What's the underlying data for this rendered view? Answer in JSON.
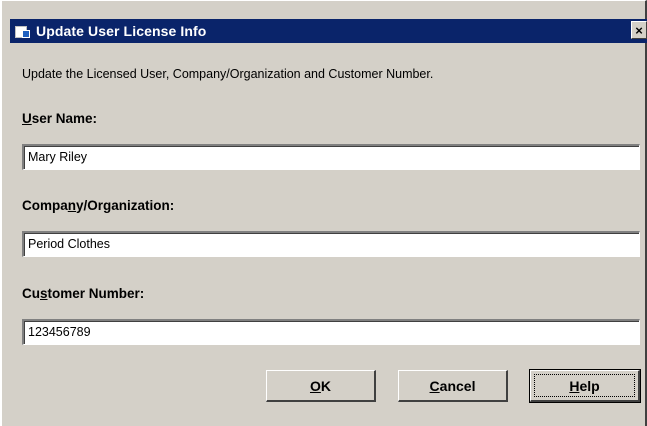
{
  "window": {
    "title": "Update User License Info",
    "close_glyph": "×",
    "icon": "app-license-icon"
  },
  "description": "Update the Licensed User, Company/Organization and Customer Number.",
  "fields": [
    {
      "label_pre": "",
      "label_ul": "U",
      "label_post": "ser Name:",
      "value": "Mary Riley"
    },
    {
      "label_pre": "Compa",
      "label_ul": "n",
      "label_post": "y/Organization:",
      "value": "Period Clothes"
    },
    {
      "label_pre": "Cu",
      "label_ul": "s",
      "label_post": "tomer Number:",
      "value": "123456789"
    }
  ],
  "buttons": {
    "ok": {
      "ul": "O",
      "rest": "K"
    },
    "cancel": {
      "ul": "C",
      "rest": "ancel"
    },
    "help": {
      "ul": "H",
      "rest": "elp"
    }
  },
  "colors": {
    "titlebar": "#0a246a",
    "dialog_bg": "#d4d0c8"
  }
}
